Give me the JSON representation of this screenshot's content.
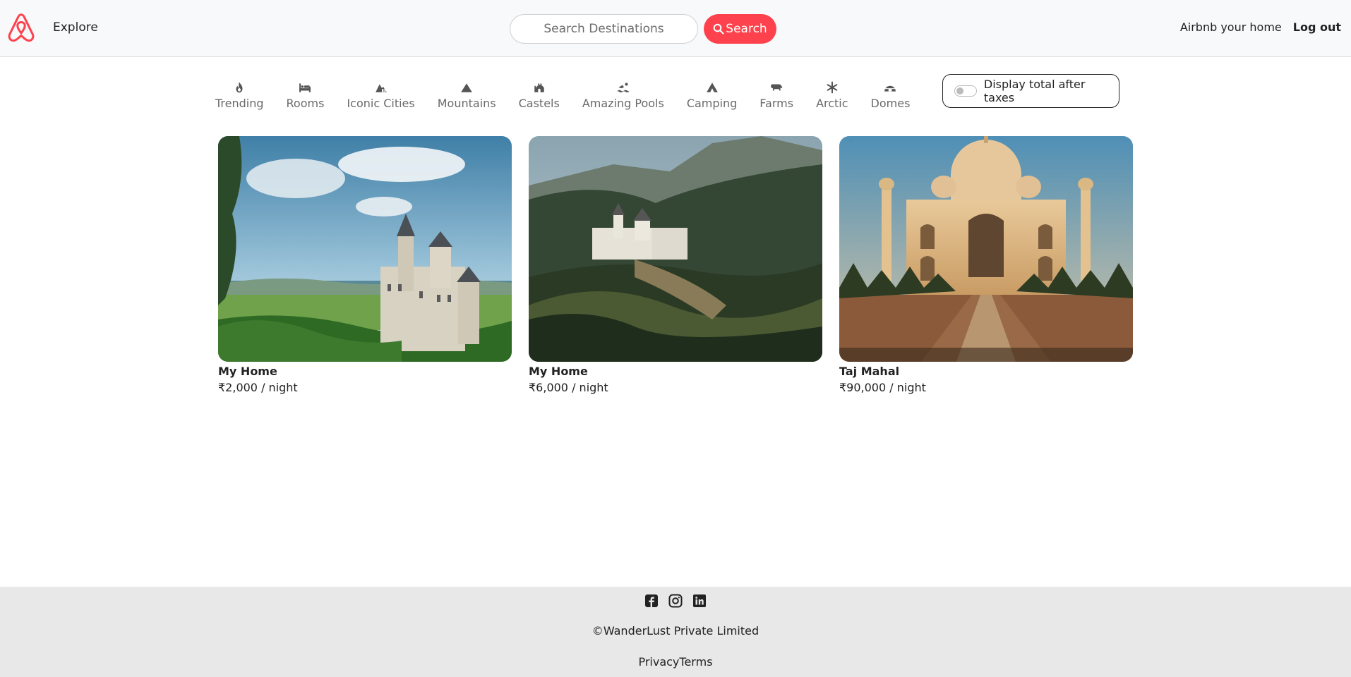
{
  "navbar": {
    "brand_icon": "airbnb-logo-icon",
    "explore_label": "Explore",
    "search_placeholder": "Search Destinations",
    "search_button_label": "Search",
    "host_link_label": "Airbnb your home",
    "logout_label": "Log out",
    "brand_color": "#fe424d"
  },
  "filters": [
    {
      "label": "Trending",
      "icon": "fire-icon"
    },
    {
      "label": "Rooms",
      "icon": "bed-icon"
    },
    {
      "label": "Iconic Cities",
      "icon": "mountain-city-icon"
    },
    {
      "label": "Mountains",
      "icon": "mountain-icon"
    },
    {
      "label": "Castels",
      "icon": "castle-icon"
    },
    {
      "label": "Amazing Pools",
      "icon": "person-swimming-icon"
    },
    {
      "label": "Camping",
      "icon": "campground-icon"
    },
    {
      "label": "Farms",
      "icon": "cow-icon"
    },
    {
      "label": "Arctic",
      "icon": "snowflake-icon"
    },
    {
      "label": "Domes",
      "icon": "igloo-icon"
    }
  ],
  "tax_toggle": {
    "label": "Display total after taxes",
    "checked": false
  },
  "listings": [
    {
      "title": "My Home",
      "price": "₹2,000 / night",
      "image": "castle-on-hill-with-lake-photo"
    },
    {
      "title": "My Home",
      "price": "₹6,000 / night",
      "image": "castle-in-forest-mountains-photo"
    },
    {
      "title": "Taj Mahal",
      "price": "₹90,000 / night",
      "image": "taj-mahal-photo"
    }
  ],
  "footer": {
    "social_icons": [
      "facebook-icon",
      "instagram-icon",
      "linkedin-icon"
    ],
    "copyright": "©WanderLust Private Limited",
    "privacy_label": "Privacy",
    "terms_label": "Terms"
  }
}
